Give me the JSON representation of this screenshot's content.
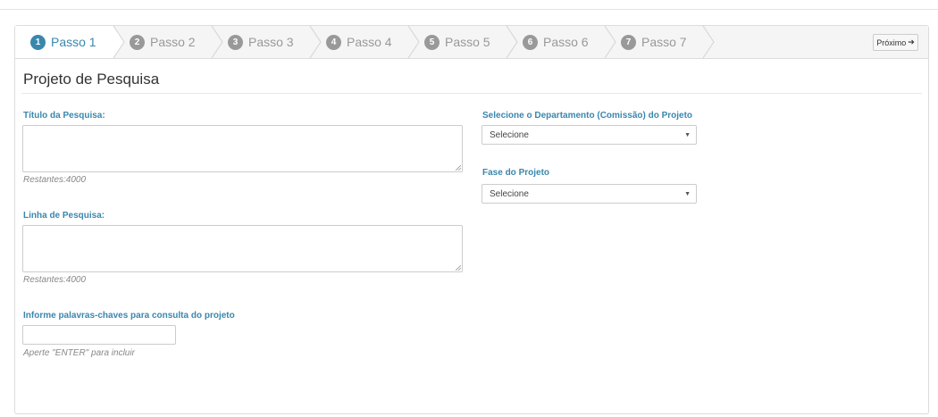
{
  "wizard": {
    "steps": [
      {
        "number": "1",
        "label": "Passo 1",
        "active": true
      },
      {
        "number": "2",
        "label": "Passo 2",
        "active": false
      },
      {
        "number": "3",
        "label": "Passo 3",
        "active": false
      },
      {
        "number": "4",
        "label": "Passo 4",
        "active": false
      },
      {
        "number": "5",
        "label": "Passo 5",
        "active": false
      },
      {
        "number": "6",
        "label": "Passo 6",
        "active": false
      },
      {
        "number": "7",
        "label": "Passo 7",
        "active": false
      }
    ],
    "next_label": "Próximo",
    "next_icon": "arrow-right-icon"
  },
  "form": {
    "title": "Projeto de Pesquisa",
    "titulo": {
      "label": "Título da Pesquisa:",
      "value": "",
      "counter": "Restantes:4000"
    },
    "linha": {
      "label": "Linha de Pesquisa:",
      "value": "",
      "counter": "Restantes:4000"
    },
    "palavras": {
      "label": "Informe palavras-chaves para consulta do projeto",
      "value": "",
      "help": "Aperte \"ENTER\" para incluir"
    },
    "departamento": {
      "label": "Selecione o Departamento (Comissão) do Projeto",
      "selected": "Selecione"
    },
    "fase": {
      "label": "Fase do Projeto",
      "selected": "Selecione"
    }
  },
  "colors": {
    "accent": "#3a87ad",
    "inactive": "#999999",
    "wizard_bg": "#f5f5f5",
    "active_tab_bg": "#ffffff"
  }
}
